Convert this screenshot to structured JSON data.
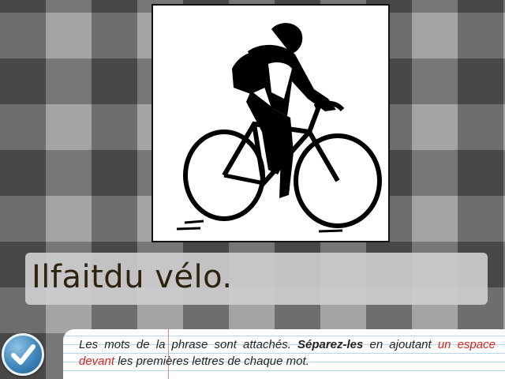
{
  "illustration": {
    "subject": "cyclist-silhouette"
  },
  "sentence": {
    "text": "Ilfaitdu vélo."
  },
  "check_button": {
    "icon": "checkmark-icon",
    "color": "#3f86bb"
  },
  "instruction": {
    "part1": "Les mots de la phrase sont attachés. ",
    "bold": "Séparez-les",
    "part2": " en ajoutant ",
    "red": "un espace devant",
    "part3": " les premières lettres de chaque mot.",
    "highlight_color": "#d9241b"
  }
}
